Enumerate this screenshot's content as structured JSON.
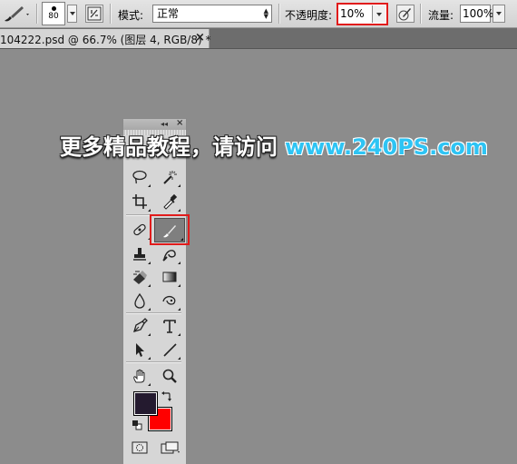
{
  "options_bar": {
    "brush_size": "80",
    "mode_label": "模式:",
    "mode_value": "正常",
    "opacity_label": "不透明度:",
    "opacity_value": "10%",
    "flow_label": "流量:",
    "flow_value": "100%",
    "highlight_color": "#e11b1b"
  },
  "document_tab": {
    "title": "104222.psd @ 66.7% (图层 4, RGB/8) *",
    "close_glyph": "×"
  },
  "watermark": {
    "chinese_text": "更多精品教程，请访问",
    "url_text": "www.240PS.com",
    "url_color": "#2ec4f4"
  },
  "tools_panel": {
    "collapse_glyph": "◂◂",
    "close_glyph": "×",
    "active_tool": "brush-tool",
    "foreground_color": "#241a2f",
    "background_color": "#ff0000"
  }
}
